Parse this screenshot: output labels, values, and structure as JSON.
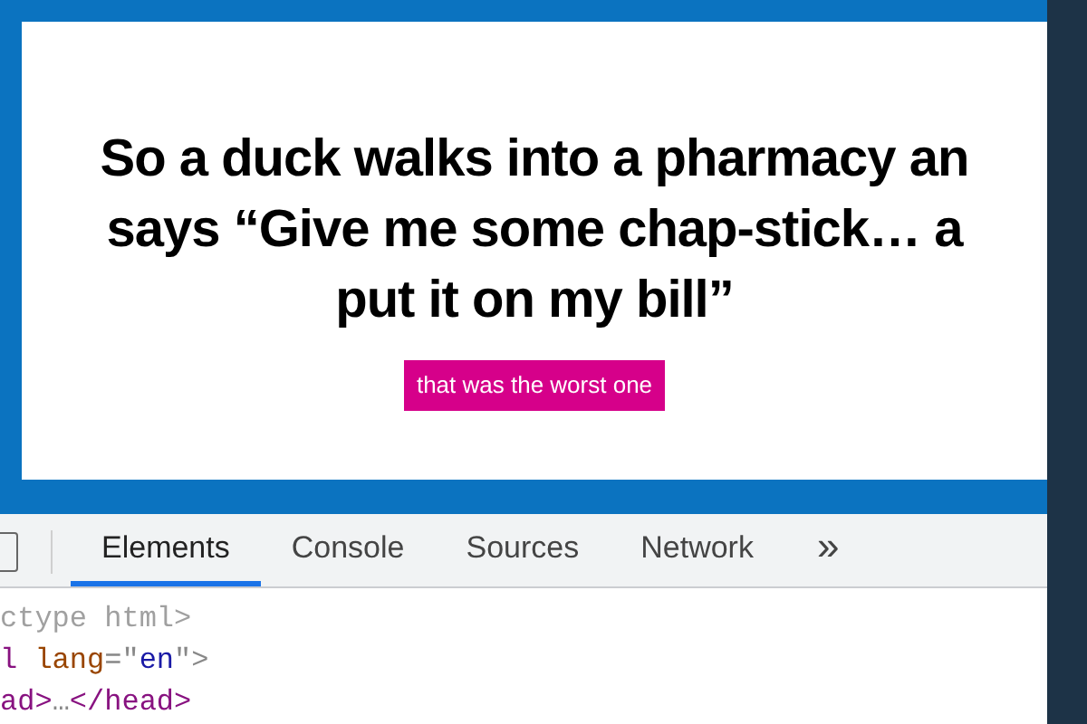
{
  "joke": {
    "lines": [
      "So a duck walks into a pharmacy an",
      "says “Give me some chap-stick… a",
      "put it on my bill”"
    ]
  },
  "button": {
    "label": "that was the worst one"
  },
  "devtools": {
    "tabs": [
      {
        "label": "Elements",
        "selected": true
      },
      {
        "label": "Console",
        "selected": false
      },
      {
        "label": "Sources",
        "selected": false
      },
      {
        "label": "Network",
        "selected": false
      }
    ],
    "more": "»",
    "code_lines": [
      [
        {
          "kind": "doctype",
          "text": "ctype html>"
        }
      ],
      [
        {
          "kind": "tag",
          "text": "l "
        },
        {
          "kind": "attr",
          "text": "lang"
        },
        {
          "kind": "punct",
          "text": "=\""
        },
        {
          "kind": "value",
          "text": "en"
        },
        {
          "kind": "punct",
          "text": "\">"
        }
      ],
      [
        {
          "kind": "tag",
          "text": "ad>"
        },
        {
          "kind": "punct",
          "text": "…"
        },
        {
          "kind": "tag",
          "text": "</head>"
        }
      ]
    ]
  }
}
